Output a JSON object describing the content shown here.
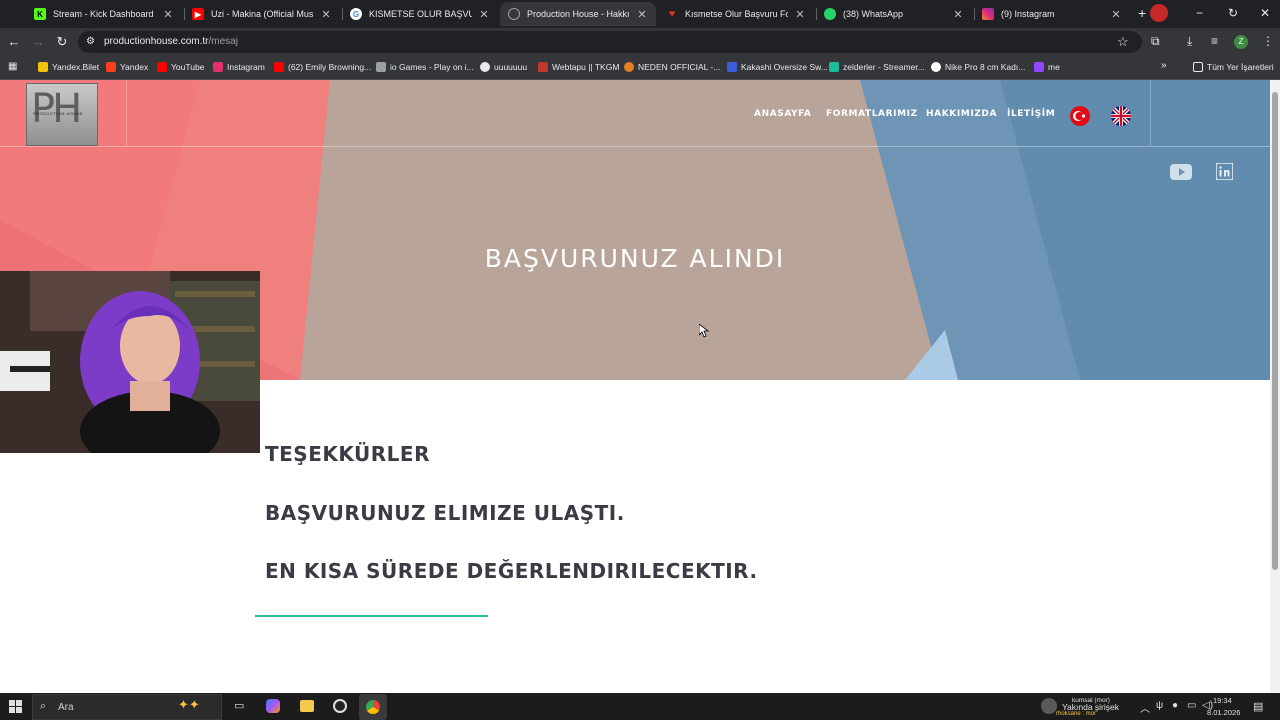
{
  "tabs": [
    {
      "title": "Stream - Kick Dashboard",
      "color": "#53fc18",
      "glyph": "K"
    },
    {
      "title": "Uzi - Makina (Official Music Vid",
      "color": "#ff0000",
      "glyph": "▶"
    },
    {
      "title": "KISMETSE OLUR BAŞVURU - Go",
      "color": "#4285f4",
      "glyph": "G"
    },
    {
      "title": "Production House - Hakkımızda",
      "color": "#9aa0a6",
      "glyph": "◌"
    },
    {
      "title": "Kısmetse Olur Başvuru Formu -",
      "color": "#d93025",
      "glyph": "♥"
    },
    {
      "title": "(38) WhatsApp",
      "color": "#25d366",
      "glyph": "W"
    },
    {
      "title": "(9) Instagram",
      "color": "#e1306c",
      "glyph": "◎"
    }
  ],
  "address": {
    "host": "productionhouse.com.tr",
    "path": "/mesaj"
  },
  "bookmarks": [
    {
      "label": "Yandex.Bilet",
      "color": "#f4c20d"
    },
    {
      "label": "Yandex",
      "color": "#fc3f1d"
    },
    {
      "label": "YouTube",
      "color": "#ff0000"
    },
    {
      "label": "Instagram",
      "color": "#e1306c"
    },
    {
      "label": "(62) Emily Browning...",
      "color": "#ff0000"
    },
    {
      "label": "io Games - Play on i...",
      "color": "#9aa0a6"
    },
    {
      "label": "uuuuuuu",
      "color": "#e8eaed"
    },
    {
      "label": "Webtapu || TKGM",
      "color": "#c0392b"
    },
    {
      "label": "NEDEN OFFICIAL -...",
      "color": "#e67e22"
    },
    {
      "label": "Kakashi Oversize Sw...",
      "color": "#3b5bdb"
    },
    {
      "label": "zelderler - Streamer...",
      "color": "#1abc9c"
    },
    {
      "label": "Nike Pro 8 cm Kadı...",
      "color": "#ffffff"
    },
    {
      "label": "me",
      "color": "#9146ff"
    }
  ],
  "bookmarks_folder": "Tüm Yer İşaretleri",
  "site": {
    "logo_text": "PH",
    "logo_sub": "PRODUCTION HOUSE",
    "nav": [
      "ANASAYFA",
      "FORMATLARIMIZ",
      "HAKKIMIZDA",
      "İLETİŞİM"
    ],
    "hero_title": "BAŞVURUNUZ ALINDI",
    "messages": [
      "TEŞEKKÜRLER",
      "BAŞVURUNUZ ELIMIZE ULAŞTI.",
      "EN KISA SÜREDE DEĞERLENDIRILECEKTIR."
    ]
  },
  "taskbar": {
    "search_placeholder": "Ara",
    "time": "19:34",
    "date": "8.01.2026",
    "tray_user": "kumsal (mor)",
    "tray_user2": "rhoksane : mor",
    "tray_notice": "Yakında şirişek"
  }
}
